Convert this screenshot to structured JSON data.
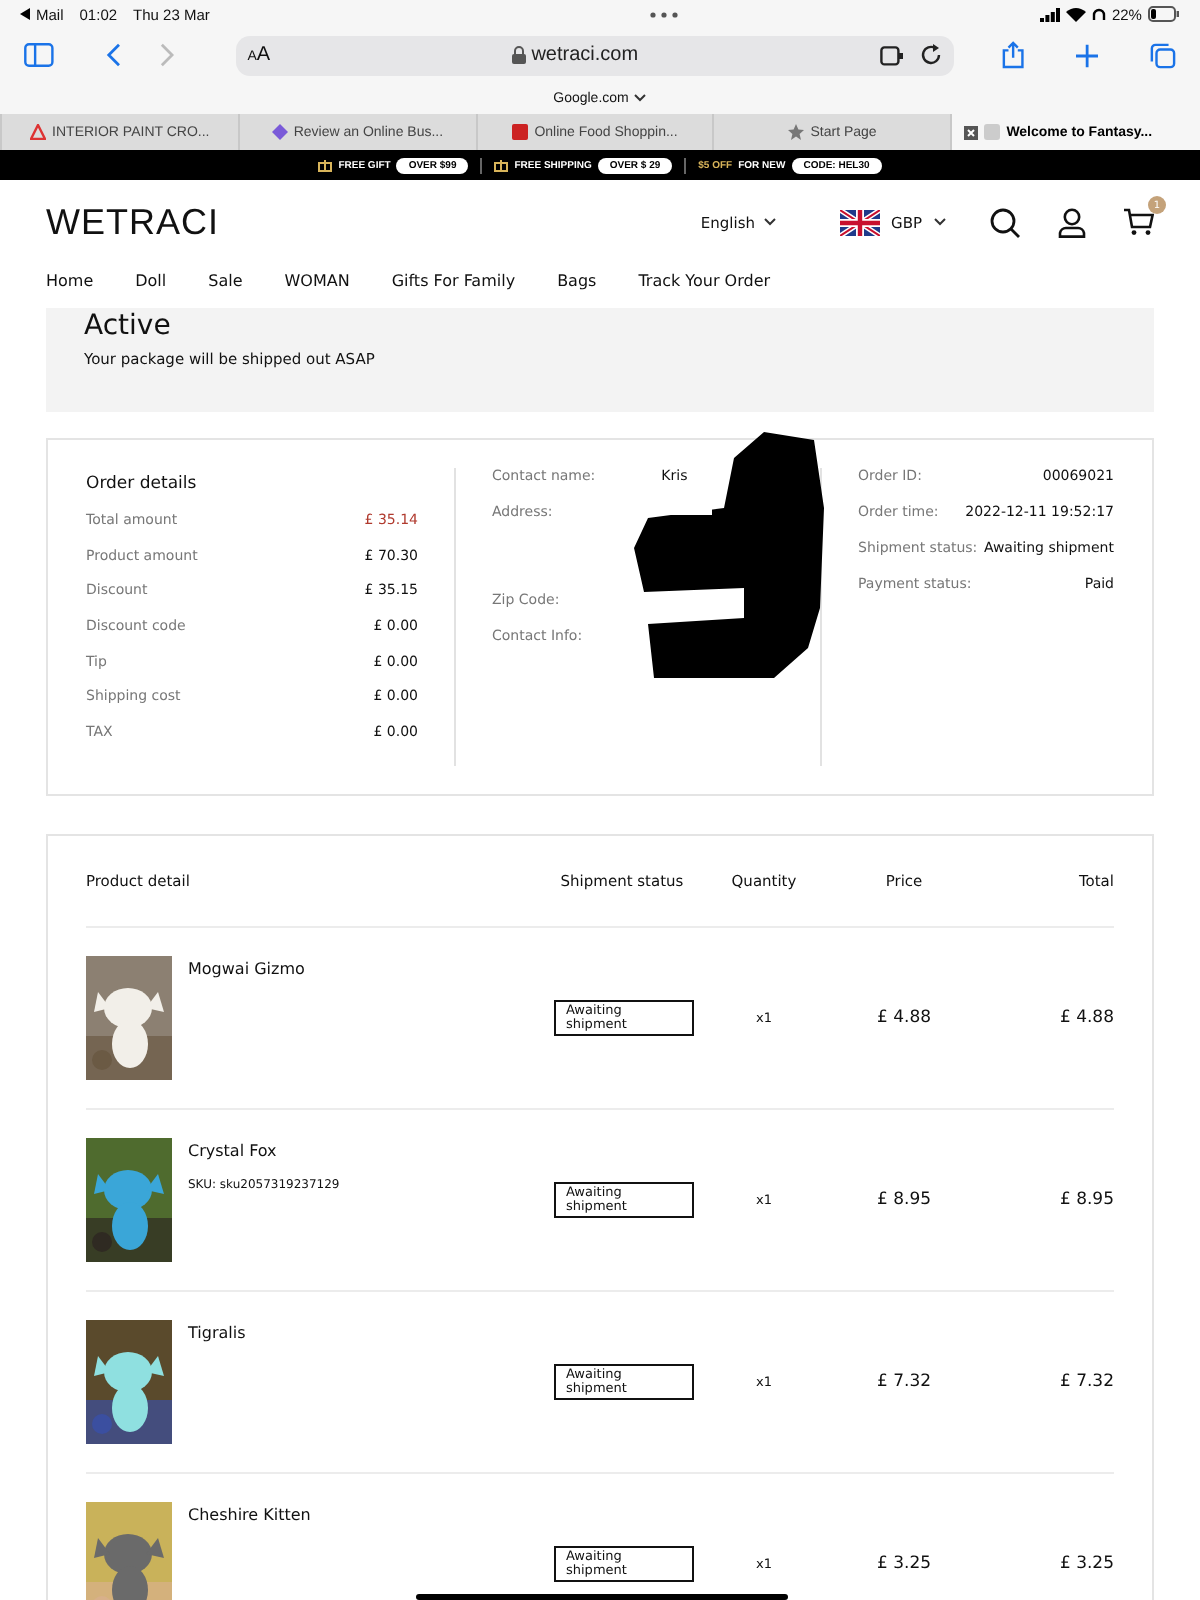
{
  "status_bar": {
    "back_app": "Mail",
    "time": "01:02",
    "date": "Thu 23 Mar",
    "battery": "22%"
  },
  "browser": {
    "text_size": "AA",
    "url": "wetraci.com",
    "suggestion": "Google.com",
    "tabs": [
      {
        "title": "INTERIOR PAINT CRO...",
        "selected": false
      },
      {
        "title": "Review an Online Bus...",
        "selected": false
      },
      {
        "title": "Online Food Shoppin...",
        "selected": false
      },
      {
        "title": "Start Page",
        "selected": false
      },
      {
        "title": "Welcome to Fantasy...",
        "selected": true
      }
    ]
  },
  "promo_bar": [
    {
      "label": "FREE GIFT",
      "badge": "OVER $99"
    },
    {
      "label": "FREE SHIPPING",
      "badge": "OVER $ 29"
    },
    {
      "highlight": "$5 OFF",
      "label": "FOR NEW",
      "badge": "CODE: HEL30"
    }
  ],
  "header": {
    "logo": "WETRACI",
    "language": "English",
    "currency": "GBP",
    "cart_count": "1",
    "nav": [
      "Home",
      "Doll",
      "Sale",
      "WOMAN",
      "Gifts For Family",
      "Bags",
      "Track Your Order"
    ]
  },
  "status_panel": {
    "title": "Active",
    "message": "Your package will be shipped out ASAP"
  },
  "order_details": {
    "title": "Order details",
    "rows": [
      {
        "label": "Total amount",
        "value": "£ 35.14",
        "emphasis": true
      },
      {
        "label": "Product amount",
        "value": "£ 70.30",
        "emphasis": false
      },
      {
        "label": "Discount",
        "value": "£ 35.15",
        "emphasis": false
      },
      {
        "label": "Discount code",
        "value": "£ 0.00",
        "emphasis": false
      },
      {
        "label": "Tip",
        "value": "£ 0.00",
        "emphasis": false
      },
      {
        "label": "Shipping cost",
        "value": "£ 0.00",
        "emphasis": false
      },
      {
        "label": "TAX",
        "value": "£ 0.00",
        "emphasis": false
      }
    ]
  },
  "contact": [
    {
      "label": "Contact name:",
      "value": "Kris"
    },
    {
      "label": "Address:"
    },
    {
      "label": "Zip Code:"
    },
    {
      "label": "Contact Info:"
    }
  ],
  "order_info": [
    {
      "label": "Order ID:",
      "value": "00069021"
    },
    {
      "label": "Order time:",
      "value": "2022-12-11 19:52:17"
    },
    {
      "label": "Shipment status:",
      "value": "Awaiting shipment"
    },
    {
      "label": "Payment status:",
      "value": "Paid"
    }
  ],
  "products": {
    "columns": [
      "Product detail",
      "Shipment status",
      "Quantity",
      "Price",
      "Total"
    ],
    "rows": [
      {
        "name": "Mogwai Gizmo",
        "shipment_status": "Awaiting shipment",
        "quantity": "x1",
        "price": "£ 4.88",
        "total": "£ 4.88"
      },
      {
        "name": "Crystal Fox",
        "sku": "SKU: sku2057319237129",
        "shipment_status": "Awaiting shipment",
        "quantity": "x1",
        "price": "£ 8.95",
        "total": "£ 8.95"
      },
      {
        "name": "Tigralis",
        "shipment_status": "Awaiting shipment",
        "quantity": "x1",
        "price": "£ 7.32",
        "total": "£ 7.32"
      },
      {
        "name": "Cheshire Kitten",
        "shipment_status": "Awaiting shipment",
        "quantity": "x1",
        "price": "£ 3.25",
        "total": "£ 3.25"
      }
    ]
  }
}
